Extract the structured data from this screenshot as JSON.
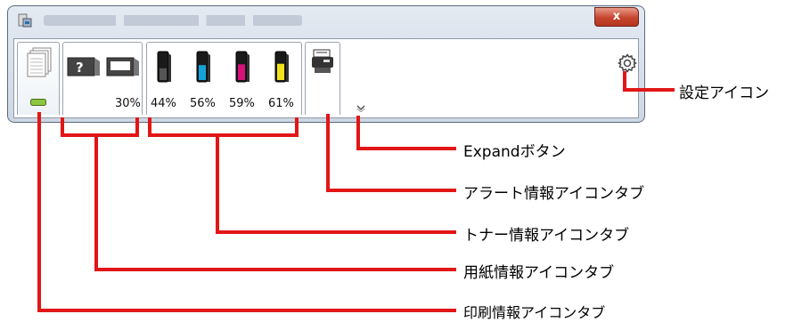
{
  "window": {
    "close_label": "x",
    "title_blurred": true
  },
  "tabs": {
    "paper_level": "30%",
    "toner_levels": [
      "44%",
      "56%",
      "59%",
      "61%"
    ]
  },
  "toner_colors": [
    "#1a1a1a",
    "#14a3d8",
    "#d6127a",
    "#f2e21a"
  ],
  "callouts": {
    "settings_icon": "設定アイコン",
    "expand_button": "Expandボタン",
    "alert_tab": "アラート情報アイコンタブ",
    "toner_tab": "トナー情報アイコンタブ",
    "paper_tab": "用紙情報アイコンタブ",
    "print_tab": "印刷情報アイコンタブ"
  },
  "callout_color": "#e21616"
}
